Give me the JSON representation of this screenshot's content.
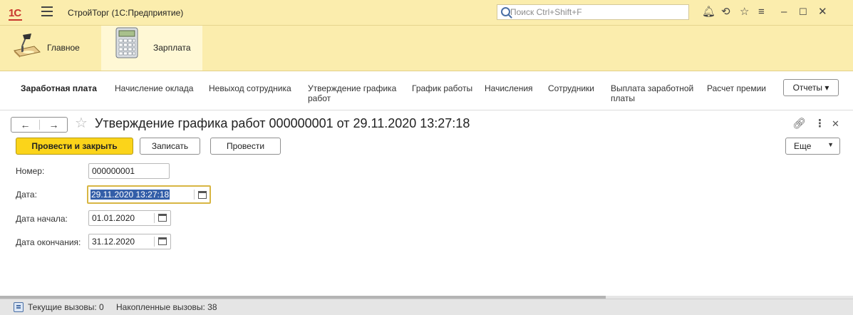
{
  "app": {
    "logo_text": "1С",
    "title": "СтройТорг  (1С:Предприятие)",
    "search_placeholder": "Поиск Ctrl+Shift+F"
  },
  "sections": [
    {
      "label": "Главное",
      "icon": "desk-lamp-icon",
      "active": false
    },
    {
      "label": "Зарплата",
      "icon": "calculator-icon",
      "active": true
    }
  ],
  "functions": {
    "section_title": "Заработная плата",
    "items": [
      "Начисление оклада",
      "Невыход сотрудника",
      "Утверждение графика\nработ",
      "График работы",
      "Начисления",
      "Сотрудники",
      "Выплата заработной\nплаты",
      "Расчет премии"
    ],
    "reports_label": "Отчеты ▾"
  },
  "form": {
    "title": "Утверждение графика работ 000000001 от 29.11.2020 13:27:18",
    "buttons": {
      "post_close": "Провести и закрыть",
      "save": "Записать",
      "post": "Провести",
      "more": "Еще"
    },
    "fields": {
      "number_label": "Номер:",
      "number_value": "000000001",
      "date_label": "Дата:",
      "date_value": "29.11.2020 13:27:18",
      "start_label": "Дата начала:",
      "start_value": "01.01.2020",
      "end_label": "Дата окончания:",
      "end_value": "31.12.2020"
    }
  },
  "status": {
    "current_calls": "Текущие вызовы: 0",
    "accumulated_calls": "Накопленные вызовы: 38"
  },
  "colors": {
    "top_bar": "#fbedad",
    "primary_button": "#fbd41a",
    "focus_border": "#d8b643",
    "selection": "#335ea8"
  }
}
